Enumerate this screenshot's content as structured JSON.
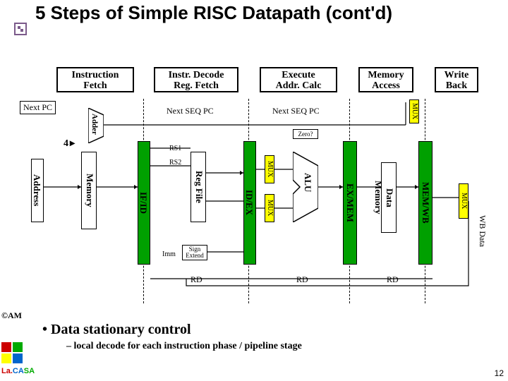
{
  "title": "5 Steps of Simple RISC Datapath (cont'd)",
  "stages": {
    "if": "Instruction\nFetch",
    "id": "Instr. Decode\nReg. Fetch",
    "ex": "Execute\nAddr. Calc",
    "mem": "Memory\nAccess",
    "wb": "Write\nBack"
  },
  "labels": {
    "nextpc": "Next PC",
    "nextseq1": "Next SEQ PC",
    "nextseq2": "Next SEQ PC",
    "four": "4",
    "adder": "Adder",
    "address": "Address",
    "memory": "Memory",
    "ifid": "IF/ID",
    "idex": "ID/EX",
    "exmem": "EX/MEM",
    "memwb": "MEM/WB",
    "regfile": "Reg File",
    "rs1": "RS1",
    "rs2": "RS2",
    "imm": "Imm",
    "signext": "Sign\nExtend",
    "zero": "Zero?",
    "alu": "ALU",
    "datamem": "Data\nMemory",
    "mux": "MUX",
    "rd": "RD",
    "wbdata": "WB Data"
  },
  "bullets": {
    "main": "Data stationary control",
    "sub": "local decode for each instruction phase / pipeline stage"
  },
  "footer": {
    "copyright": "©AM",
    "logo": "La.CASA",
    "slidenum": "12"
  }
}
